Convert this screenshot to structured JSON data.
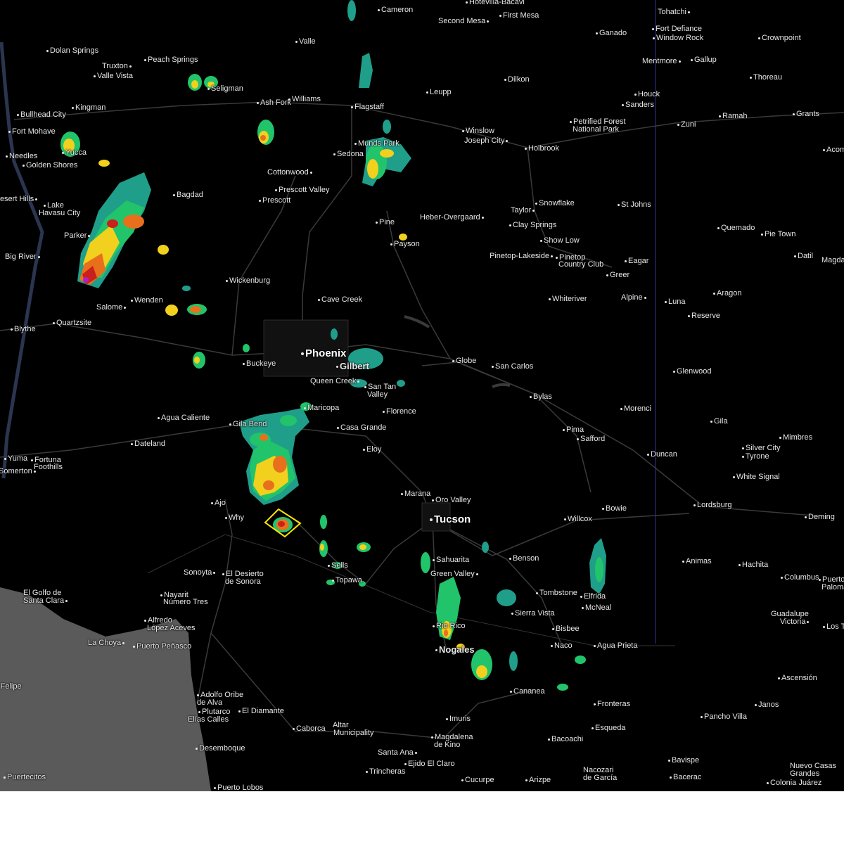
{
  "map": {
    "cities": [
      {
        "name": "Hotevilla-Bacavi"
      },
      {
        "name": "Cameron"
      },
      {
        "name": "First Mesa"
      },
      {
        "name": "Second Mesa"
      },
      {
        "name": "Tohatchi"
      },
      {
        "name": "Fort Defiance"
      },
      {
        "name": "Window Rock"
      },
      {
        "name": "Ganado"
      },
      {
        "name": "Crownpoint"
      },
      {
        "name": "Dolan Springs"
      },
      {
        "name": "Peach Springs"
      },
      {
        "name": "Truxton"
      },
      {
        "name": "Valle Vista"
      },
      {
        "name": "Valle"
      },
      {
        "name": "Mentmore"
      },
      {
        "name": "Gallup"
      },
      {
        "name": "Seligman"
      },
      {
        "name": "Leupp"
      },
      {
        "name": "Dilkon"
      },
      {
        "name": "Thoreau"
      },
      {
        "name": "Houck"
      },
      {
        "name": "Sanders"
      },
      {
        "name": "Bullhead City"
      },
      {
        "name": "Kingman"
      },
      {
        "name": "Ash Fork"
      },
      {
        "name": "Williams"
      },
      {
        "name": "Flagstaff"
      },
      {
        "name": "Grants"
      },
      {
        "name": "Ramah"
      },
      {
        "name": "Fort Mohave"
      },
      {
        "name": "Petrified Forest"
      },
      {
        "name": "National Park"
      },
      {
        "name": "Winslow"
      },
      {
        "name": "Joseph City"
      },
      {
        "name": "Holbrook"
      },
      {
        "name": "Zuni"
      },
      {
        "name": "Acoma"
      },
      {
        "name": "Needles"
      },
      {
        "name": "Yucca"
      },
      {
        "name": "Golden Shores"
      },
      {
        "name": "Sedona"
      },
      {
        "name": "Munds Park"
      },
      {
        "name": "Cottonwood"
      },
      {
        "name": "Bagdad"
      },
      {
        "name": "Prescott Valley"
      },
      {
        "name": "Prescott"
      },
      {
        "name": "Desert Hills"
      },
      {
        "name": "Lake"
      },
      {
        "name": "Havasu City"
      },
      {
        "name": "Taylor"
      },
      {
        "name": "Snowflake"
      },
      {
        "name": "St Johns"
      },
      {
        "name": "Pine"
      },
      {
        "name": "Heber-Overgaard"
      },
      {
        "name": "Clay Springs"
      },
      {
        "name": "Parker"
      },
      {
        "name": "Payson"
      },
      {
        "name": "Quemado"
      },
      {
        "name": "Pie Town"
      },
      {
        "name": "Show Low"
      },
      {
        "name": "Pinetop-Lakeside"
      },
      {
        "name": "Pinetop"
      },
      {
        "name": "Country Club"
      },
      {
        "name": "Eagar"
      },
      {
        "name": "Big River"
      },
      {
        "name": "Datil"
      },
      {
        "name": "Magdalena"
      },
      {
        "name": "Greer"
      },
      {
        "name": "Wickenburg"
      },
      {
        "name": "Alpine"
      },
      {
        "name": "Luna"
      },
      {
        "name": "Aragon"
      },
      {
        "name": "Whiteriver"
      },
      {
        "name": "Cave Creek"
      },
      {
        "name": "Salome"
      },
      {
        "name": "Wenden"
      },
      {
        "name": "Reserve"
      },
      {
        "name": "Blythe"
      },
      {
        "name": "Quartzsite"
      },
      {
        "name": "Phoenix"
      },
      {
        "name": "Buckeye"
      },
      {
        "name": "Gilbert"
      },
      {
        "name": "Globe"
      },
      {
        "name": "San Carlos"
      },
      {
        "name": "Queen Creek"
      },
      {
        "name": "Glenwood"
      },
      {
        "name": "San Tan"
      },
      {
        "name": "Valley"
      },
      {
        "name": "Bylas"
      },
      {
        "name": "Maricopa"
      },
      {
        "name": "Florence"
      },
      {
        "name": "Morenci"
      },
      {
        "name": "Agua Caliente"
      },
      {
        "name": "Gila Bend"
      },
      {
        "name": "Gila"
      },
      {
        "name": "Casa Grande"
      },
      {
        "name": "Pima"
      },
      {
        "name": "Safford"
      },
      {
        "name": "Dateland"
      },
      {
        "name": "Mimbres"
      },
      {
        "name": "Eloy"
      },
      {
        "name": "Silver City"
      },
      {
        "name": "Tyrone"
      },
      {
        "name": "Duncan"
      },
      {
        "name": "Yuma"
      },
      {
        "name": "Fortuna"
      },
      {
        "name": "Foothills"
      },
      {
        "name": "Somerton"
      },
      {
        "name": "White Signal"
      },
      {
        "name": "Marana"
      },
      {
        "name": "Ajo"
      },
      {
        "name": "Oro Valley"
      },
      {
        "name": "Lordsburg"
      },
      {
        "name": "Bowie"
      },
      {
        "name": "Tucson"
      },
      {
        "name": "Why"
      },
      {
        "name": "Willcox"
      },
      {
        "name": "Deming"
      },
      {
        "name": "Sahuarita"
      },
      {
        "name": "Benson"
      },
      {
        "name": "Animas"
      },
      {
        "name": "Hachita"
      },
      {
        "name": "Sells"
      },
      {
        "name": "Sonoyta"
      },
      {
        "name": "El Desierto"
      },
      {
        "name": "de Sonora"
      },
      {
        "name": "Green Valley"
      },
      {
        "name": "Topawa"
      },
      {
        "name": "Columbus"
      },
      {
        "name": "Puerto"
      },
      {
        "name": "Palomas"
      },
      {
        "name": "El Golfo de"
      },
      {
        "name": "Santa Clara"
      },
      {
        "name": "Tombstone"
      },
      {
        "name": "Elfrida"
      },
      {
        "name": "Nayarit"
      },
      {
        "name": "Número Tres"
      },
      {
        "name": "McNeal"
      },
      {
        "name": "Sierra Vista"
      },
      {
        "name": "Guadalupe"
      },
      {
        "name": "Victoria"
      },
      {
        "name": "Alfredo"
      },
      {
        "name": "López Aceves"
      },
      {
        "name": "Rio Rico"
      },
      {
        "name": "Bisbee"
      },
      {
        "name": "Los Tules"
      },
      {
        "name": "La Choya"
      },
      {
        "name": "Puerto Peñasco"
      },
      {
        "name": "Naco"
      },
      {
        "name": "Agua Prieta"
      },
      {
        "name": "Nogales"
      },
      {
        "name": "San Felipe"
      },
      {
        "name": "Cananea"
      },
      {
        "name": "Ascensión"
      },
      {
        "name": "Adolfo Oribe"
      },
      {
        "name": "de Alva"
      },
      {
        "name": "Fronteras"
      },
      {
        "name": "Janos"
      },
      {
        "name": "Plutarco"
      },
      {
        "name": "Elías Calles"
      },
      {
        "name": "El Diamante"
      },
      {
        "name": "Pancho Villa"
      },
      {
        "name": "Imuris"
      },
      {
        "name": "Esqueda"
      },
      {
        "name": "Caborca"
      },
      {
        "name": "Altar"
      },
      {
        "name": "Municipality"
      },
      {
        "name": "Santa Ana"
      },
      {
        "name": "Magdalena"
      },
      {
        "name": "de Kino"
      },
      {
        "name": "Bacoachi"
      },
      {
        "name": "Desemboque"
      },
      {
        "name": "Ejido El Claro"
      },
      {
        "name": "Bavispe"
      },
      {
        "name": "Nuevo Casas"
      },
      {
        "name": "Grandes"
      },
      {
        "name": "Trincheras"
      },
      {
        "name": "Nacozari"
      },
      {
        "name": "de García"
      },
      {
        "name": "Bacerac"
      },
      {
        "name": "Puertecitos"
      },
      {
        "name": "Cucurpe"
      },
      {
        "name": "Arizpe"
      },
      {
        "name": "Colonia Juárez"
      },
      {
        "name": "Puerto Lobos"
      }
    ],
    "colors": {
      "background": "#000000",
      "ocean": "#5a5a5a",
      "river": "#2b3550",
      "roads": "#3a3a3a",
      "state_border": "#2a2a8c",
      "light_rain": "#1f9e8a",
      "rain": "#21c46a",
      "moderate": "#c8d616",
      "heavy": "#f2d01e",
      "severe": "#e8701c",
      "intense": "#c8201c",
      "extreme": "#b41ec0",
      "warning_box": "#ffe600"
    }
  }
}
